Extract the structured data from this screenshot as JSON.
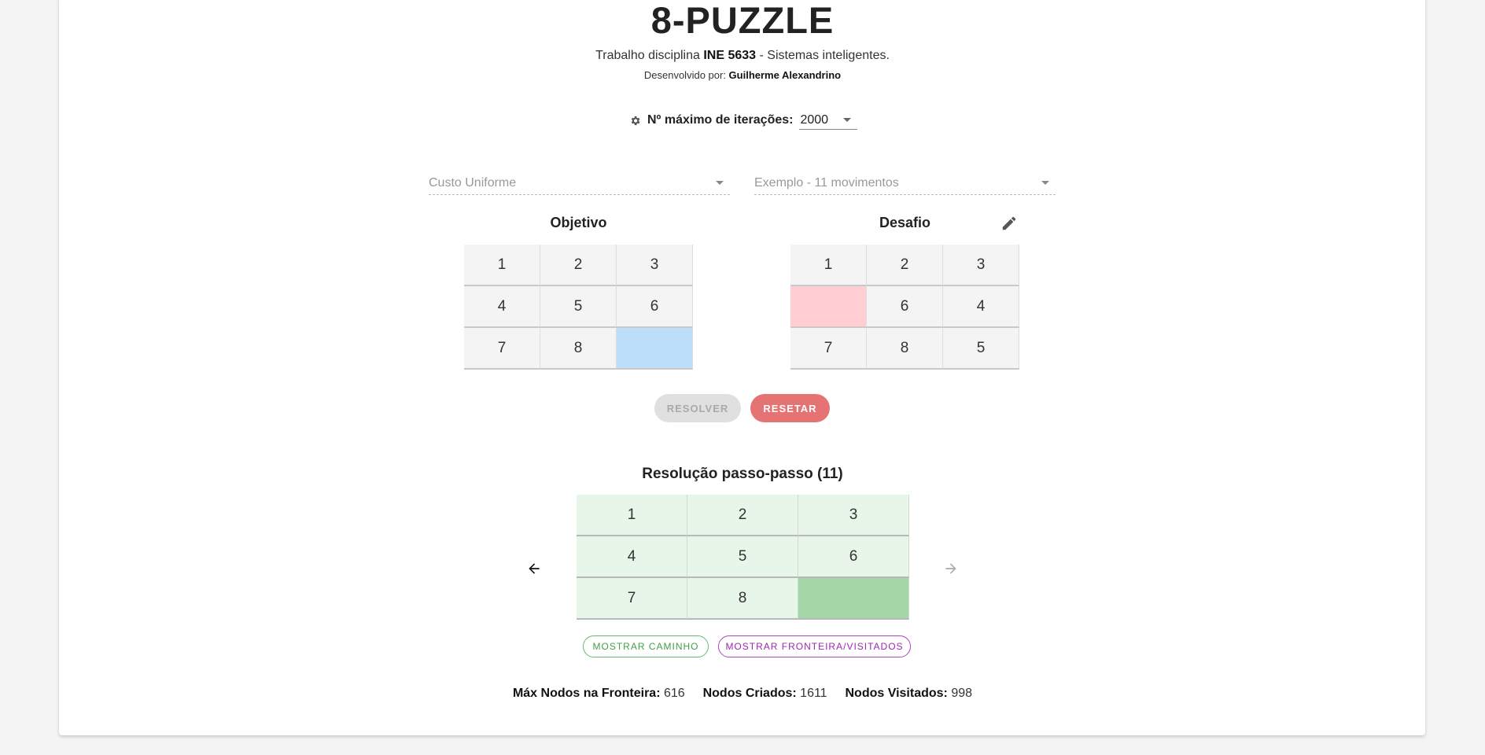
{
  "header": {
    "title": "8-PUZZLE",
    "subtitle_prefix": "Trabalho disciplina ",
    "subtitle_course": "INE 5633",
    "subtitle_suffix": " - Sistemas inteligentes.",
    "dev_prefix": "Desenvolvido por: ",
    "dev_name": "Guilherme Alexandrino"
  },
  "iterations": {
    "icon": "gear-icon",
    "label": "Nº máximo de iterações:",
    "value": "2000"
  },
  "selects": {
    "algorithm": "Custo Uniforme",
    "example": "Exemplo - 11 movimentos"
  },
  "goal": {
    "title": "Objetivo",
    "tiles": [
      "1",
      "2",
      "3",
      "4",
      "5",
      "6",
      "7",
      "8",
      ""
    ]
  },
  "challenge": {
    "title": "Desafio",
    "edit_icon": "pencil-icon",
    "tiles": [
      "1",
      "2",
      "3",
      "",
      "6",
      "4",
      "7",
      "8",
      "5"
    ]
  },
  "actions": {
    "resolver": "RESOLVER",
    "resetar": "RESETAR"
  },
  "steps": {
    "title": "Resolução passo-passo (11)",
    "tiles": [
      "1",
      "2",
      "3",
      "4",
      "5",
      "6",
      "7",
      "8",
      ""
    ],
    "prev_icon": "arrow-left-icon",
    "next_icon": "arrow-right-icon"
  },
  "view_buttons": {
    "caminho": "MOSTRAR CAMINHO",
    "fronteira": "MOSTRAR FRONTEIRA/VISITADOS"
  },
  "stats": {
    "max_fronteira_label": "Máx Nodos na Fronteira:",
    "max_fronteira_value": "616",
    "criados_label": "Nodos Criados:",
    "criados_value": "1611",
    "visitados_label": "Nodos Visitados:",
    "visitados_value": "998"
  },
  "colors": {
    "goal_blank": "#bbdefb",
    "challenge_blank": "#ffcdd2",
    "step_tile": "#e8f5e9",
    "step_blank": "#a5d6a7",
    "reset_button": "#e57373",
    "caminho_accent": "#43a047",
    "fronteira_accent": "#9c27b0"
  }
}
